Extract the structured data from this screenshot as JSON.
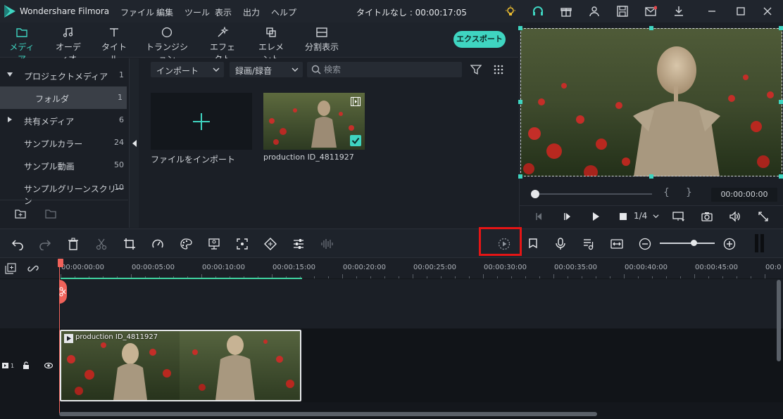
{
  "titlebar": {
    "app_name": "Wondershare Filmora",
    "menu": [
      "ファイル",
      "編集",
      "ツール",
      "表示",
      "出力",
      "ヘルプ"
    ],
    "project_title": "タイトルなし : 00:00:17:05",
    "icons": [
      "bulb-icon",
      "headset-icon",
      "gift-icon",
      "user-icon",
      "save-icon",
      "mail-icon",
      "download-icon",
      "minimize-icon",
      "maximize-icon",
      "close-icon"
    ]
  },
  "media_tabs": {
    "tabs": [
      {
        "label": "メディア",
        "icon": "folder-icon",
        "active": true
      },
      {
        "label": "オーディオ",
        "icon": "music-note-icon",
        "active": false
      },
      {
        "label": "タイトル",
        "icon": "text-icon",
        "active": false
      },
      {
        "label": "トランジション",
        "icon": "transition-icon",
        "active": false
      },
      {
        "label": "エフェクト",
        "icon": "effect-icon",
        "active": false
      },
      {
        "label": "エレメント",
        "icon": "element-icon",
        "active": false
      },
      {
        "label": "分割表示",
        "icon": "split-screen-icon",
        "active": false
      }
    ],
    "export_label": "エクスポート"
  },
  "sidebar": {
    "items": [
      {
        "label": "プロジェクトメディア",
        "count": "1",
        "expanded": true
      },
      {
        "label": "フォルダ",
        "count": "1",
        "selected": true
      },
      {
        "label": "共有メディア",
        "count": "6",
        "expanded": false
      },
      {
        "label": "サンプルカラー",
        "count": "24"
      },
      {
        "label": "サンプル動画",
        "count": "50"
      },
      {
        "label": "サンプルグリーンスクリーン",
        "count": "10"
      }
    ]
  },
  "media_area": {
    "import_dropdown": "インポート",
    "record_dropdown": "録画/録音",
    "search_placeholder": "検索",
    "import_tile_label": "ファイルをインポート",
    "clip_label": "production ID_4811927"
  },
  "preview": {
    "timecode": "00:00:00:00",
    "quality": "1/4",
    "brace_open": "{",
    "brace_close": "}"
  },
  "timeline": {
    "ruler_labels": [
      "00:00:00:00",
      "00:00:05:00",
      "00:00:10:00",
      "00:00:15:00",
      "00:00:20:00",
      "00:00:25:00",
      "00:00:30:00",
      "00:00:35:00",
      "00:00:40:00",
      "00:00:45:00",
      "00:0"
    ],
    "clip_name": "production ID_4811927",
    "track_number": "1"
  },
  "colors": {
    "accent": "#3fd5c1",
    "playhead": "#f0625a",
    "highlight": "#e51515"
  }
}
